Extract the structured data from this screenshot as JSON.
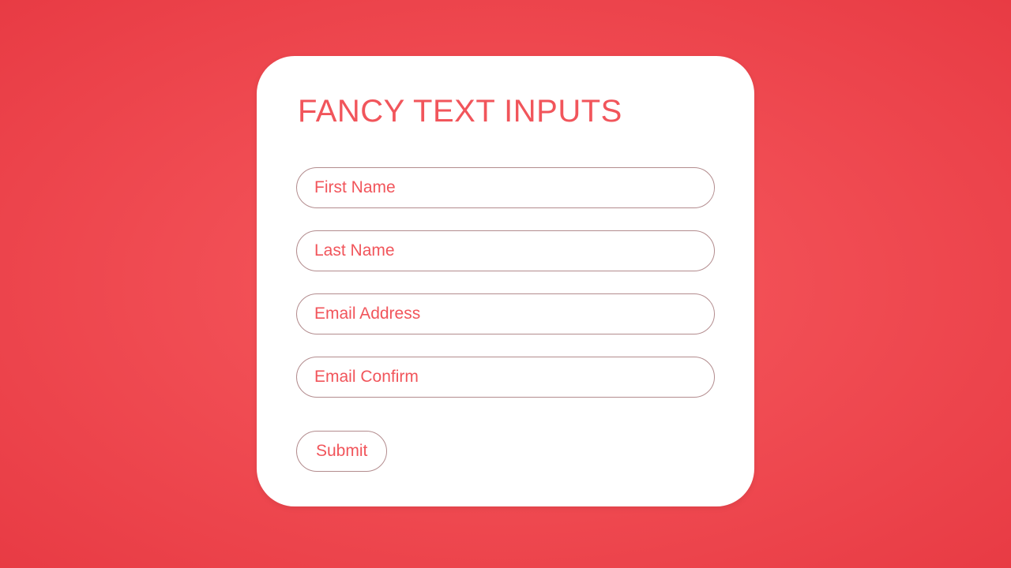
{
  "form": {
    "title": "FANCY TEXT INPUTS",
    "fields": {
      "first_name": {
        "placeholder": "First Name",
        "value": ""
      },
      "last_name": {
        "placeholder": "Last Name",
        "value": ""
      },
      "email": {
        "placeholder": "Email Address",
        "value": ""
      },
      "email_confirm": {
        "placeholder": "Email Confirm",
        "value": ""
      }
    },
    "submit_label": "Submit"
  },
  "colors": {
    "accent": "#f1555b",
    "background": "#e83b44",
    "card": "#ffffff",
    "border": "#b38c8e"
  }
}
